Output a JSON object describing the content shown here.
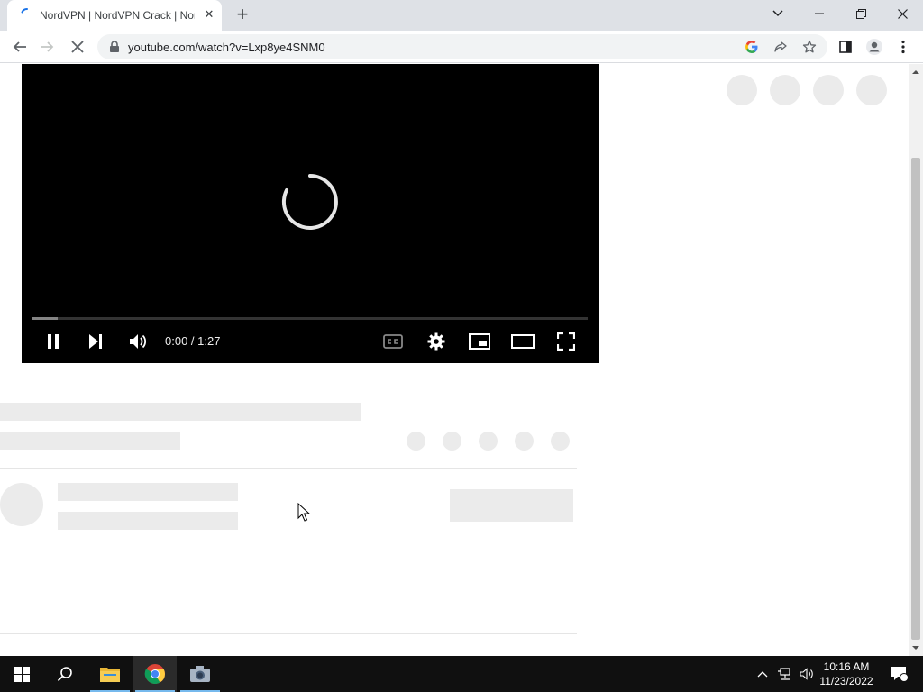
{
  "browser": {
    "tab_title": "NordVPN | NordVPN Crack | NordVPN",
    "tab_close": "✕",
    "new_tab": "+",
    "url": "youtube.com/watch?v=Lxp8ye4SNM0"
  },
  "player": {
    "time": "0:00 / 1:27",
    "progress_loaded": 0.045
  },
  "taskbar": {
    "clock_time": "10:16 AM",
    "clock_date": "11/23/2022",
    "notification_count": "1"
  },
  "colors": {
    "tab_strip": "#dee1e6",
    "player_bg": "#000000",
    "placeholder": "#ebebeb",
    "taskbar": "#101010",
    "taskbar_accent": "#76b9ed"
  }
}
